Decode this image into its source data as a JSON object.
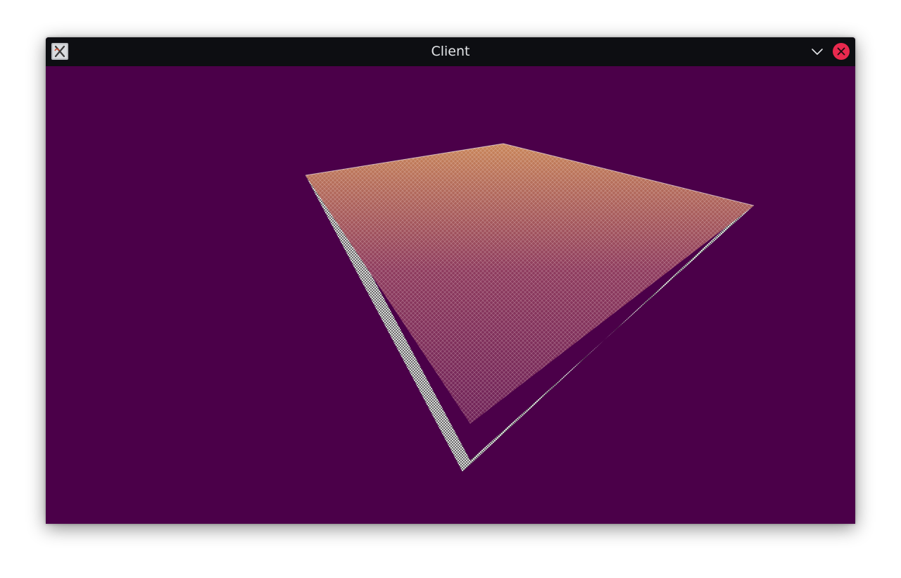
{
  "window": {
    "title": "Client",
    "icons": {
      "app": "app-icon",
      "minimize": "chevron-down-icon",
      "close": "close-icon"
    },
    "colors": {
      "titlebar": "#0d0e12",
      "title_text": "#e3e5e8",
      "close_button": "#e9294e"
    }
  },
  "viewport": {
    "background": "#4b0049",
    "scene": "wireframe-terrain-block",
    "colors": {
      "top_surface_far": "#c8865a",
      "top_surface_near": "#6e2258",
      "wireframe_sides": "#ffffff"
    }
  }
}
